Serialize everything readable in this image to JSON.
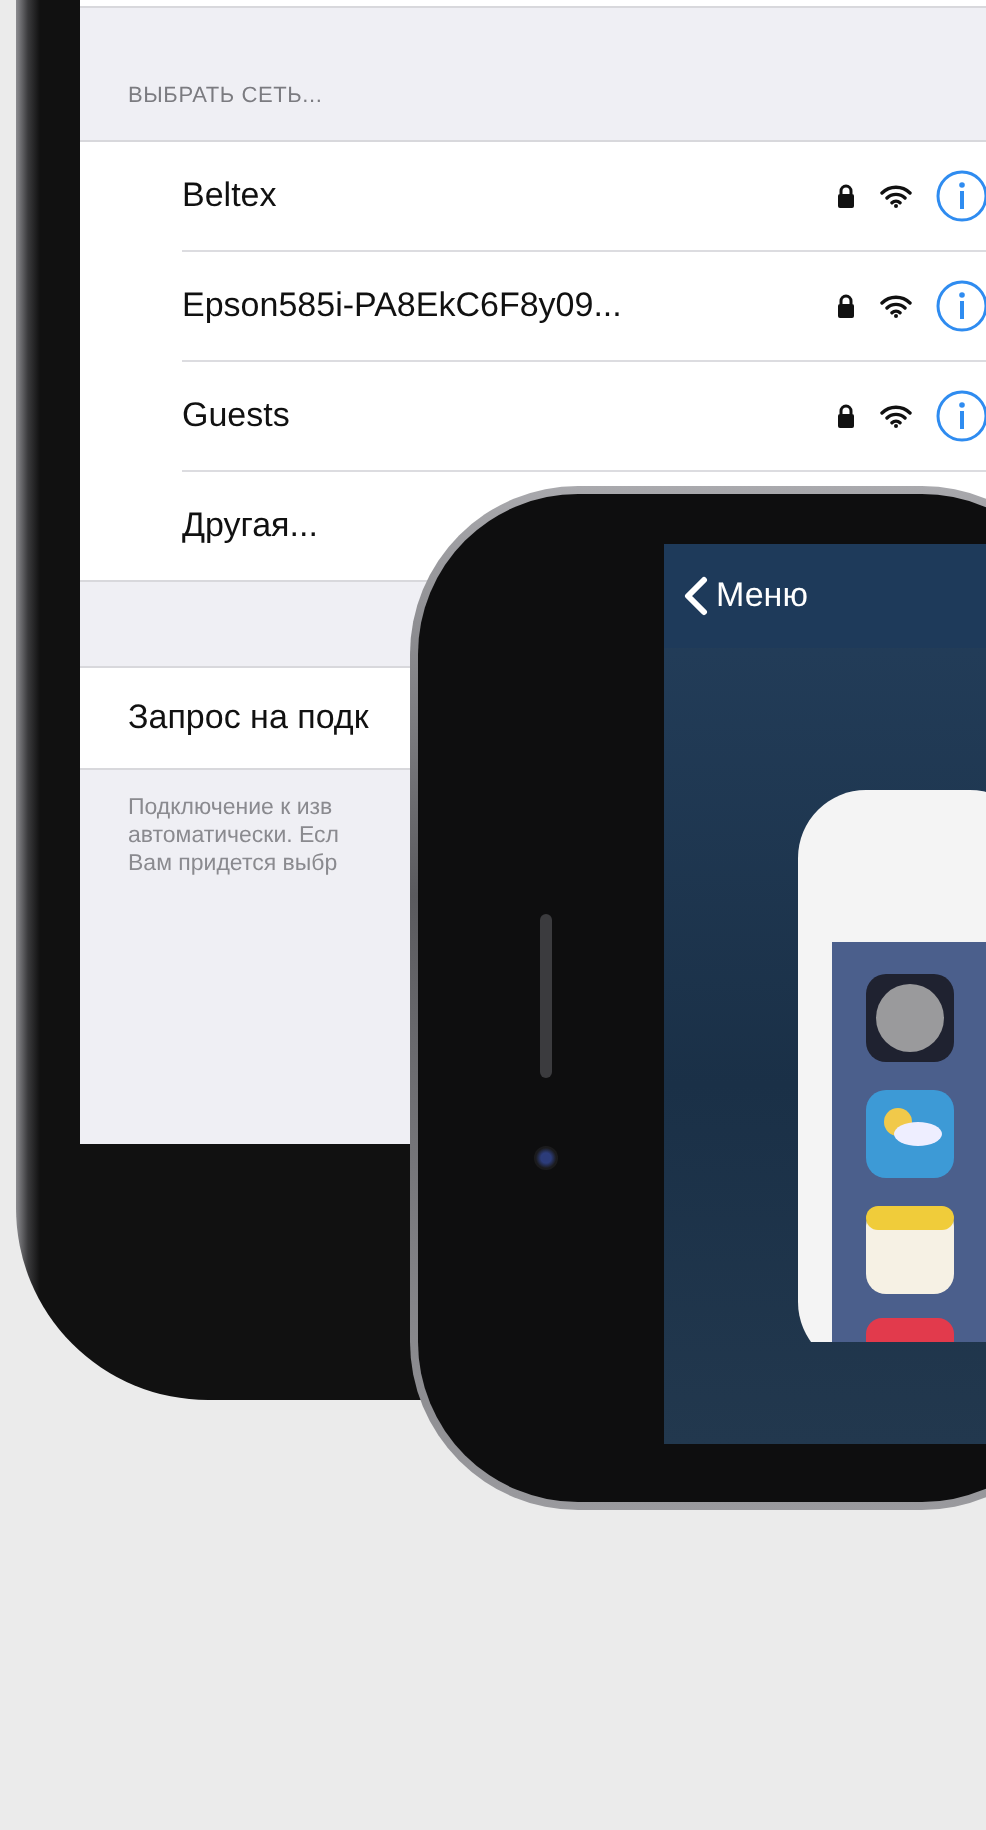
{
  "settings_screen": {
    "section_header": "ВЫБРАТЬ СЕТЬ...",
    "networks": [
      {
        "kind": "network",
        "name": "Beltex"
      },
      {
        "kind": "network",
        "name": "Epson585i-PA8EkC6F8y09..."
      },
      {
        "kind": "network",
        "name": "Guests"
      },
      {
        "kind": "other",
        "name": "Другая..."
      }
    ],
    "ask_to_join_row": "Запрос на подк",
    "footer_lines": [
      "Подключение к изв",
      "автоматически. Есл",
      "Вам придется выбр"
    ]
  },
  "app_screen": {
    "back_button": "Меню"
  }
}
